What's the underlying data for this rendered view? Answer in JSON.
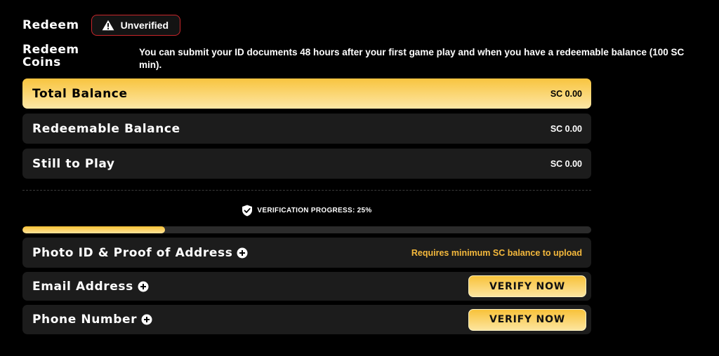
{
  "header": {
    "title": "Redeem",
    "status_badge": {
      "icon": "warning-icon",
      "label": "Unverified",
      "border_color": "#c8262b"
    }
  },
  "redeem_section": {
    "heading": "Redeem Coins",
    "description": "You can submit your ID documents 48 hours after your first game play and when you have a redeemable balance (100 SC min)."
  },
  "balances": [
    {
      "label": "Total Balance",
      "value": "SC 0.00"
    },
    {
      "label": "Redeemable Balance",
      "value": "SC 0.00"
    },
    {
      "label": "Still to Play",
      "value": "SC 0.00"
    }
  ],
  "verification": {
    "icon": "shield-check-icon",
    "label": "VERIFICATION PROGRESS: 25%",
    "progress_percent": 25,
    "accent_color": "#f8c23a"
  },
  "verification_items": [
    {
      "label": "Photo ID & Proof of Address",
      "icon": "plus-circle-icon",
      "hint": "Requires minimum SC balance to upload"
    },
    {
      "label": "Email Address",
      "icon": "plus-circle-icon",
      "action": "VERIFY NOW"
    },
    {
      "label": "Phone Number",
      "icon": "plus-circle-icon",
      "action": "VERIFY NOW"
    }
  ]
}
